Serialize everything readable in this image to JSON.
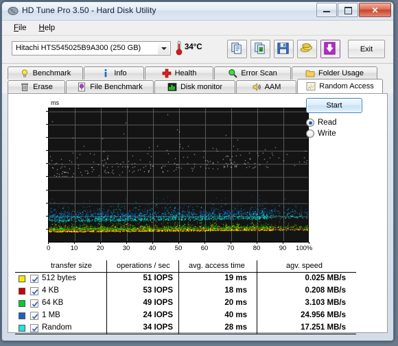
{
  "window": {
    "title": "HD Tune Pro 3.50 - Hard Disk Utility",
    "icon": "hdtune-disk-icon",
    "controls": {
      "minimize": "minimize-icon",
      "maximize": "maximize-icon",
      "close": "✕"
    }
  },
  "menu": {
    "items": [
      {
        "label": "File",
        "accel": "F"
      },
      {
        "label": "Help",
        "accel": "H"
      }
    ]
  },
  "toolbar": {
    "drive": {
      "selected": "Hitachi HTS545025B9A300 (250 GB)",
      "icon": "chevron-down-icon"
    },
    "temperature": {
      "value": "34°C",
      "icon": "thermometer-icon"
    },
    "buttons": [
      {
        "name": "copy-to-clipboard-button",
        "icon": "copy-documents-icon"
      },
      {
        "name": "copy-screenshot-button",
        "icon": "copy-image-icon"
      },
      {
        "name": "save-button",
        "icon": "floppy-disk-icon"
      },
      {
        "name": "options-button",
        "icon": "gold-coins-icon"
      },
      {
        "name": "download-update-button",
        "icon": "download-arrow-icon"
      }
    ],
    "exit_label": "Exit"
  },
  "tabs": {
    "row1": [
      {
        "label": "Benchmark",
        "icon": "lightbulb-icon",
        "active": false
      },
      {
        "label": "Info",
        "icon": "info-icon",
        "active": false
      },
      {
        "label": "Health",
        "icon": "red-cross-icon",
        "active": false
      },
      {
        "label": "Error Scan",
        "icon": "magnifier-icon",
        "active": false
      },
      {
        "label": "Folder Usage",
        "icon": "folder-icon",
        "active": false
      }
    ],
    "row2": [
      {
        "label": "Erase",
        "icon": "trash-can-icon",
        "active": false
      },
      {
        "label": "File Benchmark",
        "icon": "file-bulb-icon",
        "active": false
      },
      {
        "label": "Disk monitor",
        "icon": "bar-chart-icon",
        "active": false
      },
      {
        "label": "AAM",
        "icon": "speaker-icon",
        "active": false
      },
      {
        "label": "Random Access",
        "icon": "scatter-plot-icon",
        "active": true
      }
    ]
  },
  "controls": {
    "start_label": "Start",
    "mode_read": "Read",
    "mode_write": "Write",
    "mode_selected": "Read"
  },
  "chart_data": {
    "type": "scatter",
    "title": "",
    "xlabel": "",
    "ylabel": "ms",
    "yunit": "ms",
    "xunit": "%",
    "xlim": [
      0,
      100
    ],
    "ylim": [
      0,
      205
    ],
    "yticks": [
      20,
      40,
      60,
      80,
      100,
      120,
      140,
      160,
      180,
      200
    ],
    "xticks": [
      0,
      10,
      20,
      30,
      40,
      50,
      60,
      70,
      80,
      90,
      100
    ],
    "xtick_labels": [
      "0",
      "10",
      "20",
      "30",
      "40",
      "50",
      "60",
      "70",
      "80",
      "90",
      "100%"
    ],
    "grid": true,
    "background": "#141414",
    "gridcolor": "#5a5a5a",
    "legend_position": "table-below",
    "series": [
      {
        "name": "512 bytes",
        "color": "#ffff00",
        "marker_count": 1400,
        "band_ms": [
          8,
          30
        ]
      },
      {
        "name": "4 KB",
        "color": "#cc0000",
        "marker_count": 1400,
        "band_ms": [
          9,
          32
        ]
      },
      {
        "name": "64 KB",
        "color": "#00cc00",
        "marker_count": 1400,
        "band_ms": [
          10,
          34
        ]
      },
      {
        "name": "1 MB",
        "color": "#1060c0",
        "marker_count": 1100,
        "band_ms": [
          18,
          70
        ]
      },
      {
        "name": "Random",
        "color": "#00e0e0",
        "marker_count": 1200,
        "band_ms": [
          14,
          60
        ]
      },
      {
        "name": "outliers",
        "color": "#e8e8e8",
        "marker_count": 260,
        "band_ms": [
          40,
          195
        ]
      }
    ]
  },
  "results": {
    "columns": [
      "transfer size",
      "operations / sec",
      "avg. access time",
      "agv. speed"
    ],
    "rows": [
      {
        "color": "#ffe800",
        "checked": true,
        "transfer_size": "512 bytes",
        "ops": "51 IOPS",
        "access_time": "19 ms",
        "speed": "0.025 MB/s"
      },
      {
        "color": "#d00000",
        "checked": true,
        "transfer_size": "4 KB",
        "ops": "53 IOPS",
        "access_time": "18 ms",
        "speed": "0.208 MB/s"
      },
      {
        "color": "#00cc33",
        "checked": true,
        "transfer_size": "64 KB",
        "ops": "49 IOPS",
        "access_time": "20 ms",
        "speed": "3.103 MB/s"
      },
      {
        "color": "#1a63c4",
        "checked": true,
        "transfer_size": "1 MB",
        "ops": "24 IOPS",
        "access_time": "40 ms",
        "speed": "24.956 MB/s"
      },
      {
        "color": "#22e3d6",
        "checked": true,
        "transfer_size": "Random",
        "ops": "34 IOPS",
        "access_time": "28 ms",
        "speed": "17.251 MB/s"
      }
    ]
  }
}
